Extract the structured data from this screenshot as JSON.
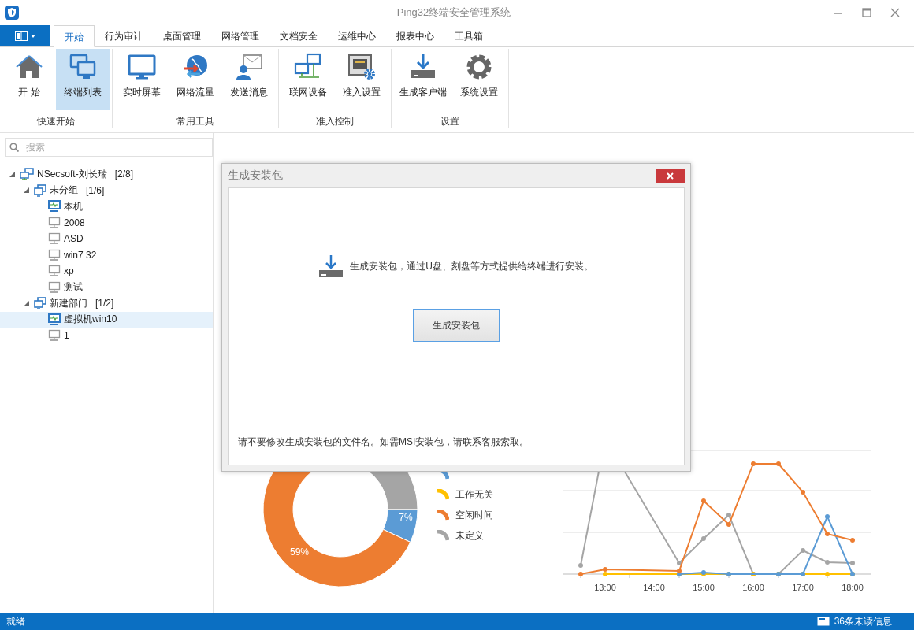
{
  "window": {
    "title": "Ping32终端安全管理系统"
  },
  "ribbon_tabs": [
    {
      "label": "开始",
      "selected": true
    },
    {
      "label": "行为审计",
      "selected": false
    },
    {
      "label": "桌面管理",
      "selected": false
    },
    {
      "label": "网络管理",
      "selected": false
    },
    {
      "label": "文档安全",
      "selected": false
    },
    {
      "label": "运维中心",
      "selected": false
    },
    {
      "label": "报表中心",
      "selected": false
    },
    {
      "label": "工具箱",
      "selected": false
    }
  ],
  "ribbon_groups": [
    {
      "label": "快速开始",
      "buttons": [
        {
          "label": "开 始",
          "kind": "home",
          "selected": false
        },
        {
          "label": "终端列表",
          "kind": "monitors",
          "selected": true
        }
      ]
    },
    {
      "label": "常用工具",
      "buttons": [
        {
          "label": "实时屏幕",
          "kind": "monitor",
          "selected": false
        },
        {
          "label": "网络流量",
          "kind": "globe",
          "selected": false
        },
        {
          "label": "发送消息",
          "kind": "message",
          "selected": false
        }
      ]
    },
    {
      "label": "准入控制",
      "buttons": [
        {
          "label": "联网设备",
          "kind": "network",
          "selected": false
        },
        {
          "label": "准入设置",
          "kind": "port",
          "selected": false
        }
      ]
    },
    {
      "label": "设置",
      "buttons": [
        {
          "label": "生成客户端",
          "kind": "download",
          "selected": false
        },
        {
          "label": "系统设置",
          "kind": "gear",
          "selected": false
        }
      ]
    }
  ],
  "sidebar": {
    "search": {
      "placeholder": "搜索"
    },
    "tree": [
      {
        "label": "NSecsoft-刘长瑞",
        "count": "[2/8]",
        "kind": "network",
        "expanded": true,
        "children": [
          {
            "label": "未分组",
            "count": "[1/6]",
            "kind": "group",
            "expanded": true,
            "children": [
              {
                "label": "本机",
                "kind": "terminal",
                "online": true,
                "selected": false
              },
              {
                "label": "2008",
                "kind": "terminal",
                "online": false,
                "selected": false
              },
              {
                "label": "ASD",
                "kind": "terminal",
                "online": false,
                "selected": false
              },
              {
                "label": "win7 32",
                "kind": "terminal",
                "online": false,
                "selected": false
              },
              {
                "label": "xp",
                "kind": "terminal",
                "online": false,
                "selected": false
              },
              {
                "label": "测试",
                "kind": "terminal",
                "online": false,
                "selected": false
              }
            ]
          },
          {
            "label": "新建部门",
            "count": "[1/2]",
            "kind": "group",
            "expanded": true,
            "children": [
              {
                "label": "虚拟机win10",
                "kind": "terminal",
                "online": true,
                "selected": true
              },
              {
                "label": "1",
                "kind": "terminal",
                "online": false,
                "selected": false
              }
            ]
          }
        ]
      }
    ]
  },
  "donut": {
    "labels": [
      "59%",
      "7%"
    ]
  },
  "legend": [
    {
      "color": "#5b9bd5"
    },
    {
      "label": "工作无关",
      "color": "#ffc000"
    },
    {
      "label": "空闲时间",
      "color": "#ed7d31"
    },
    {
      "label": "未定义",
      "color": "#a5a5a5"
    }
  ],
  "line_chart": {
    "x_labels": [
      "13:00",
      "14:00",
      "15:00",
      "16:00",
      "17:00",
      "18:00"
    ]
  },
  "dialog": {
    "title": "生成安装包",
    "message": "生成安装包，通过U盘、刻盘等方式提供给终端进行安装。",
    "button": "生成安装包",
    "note": "请不要修改生成安装包的文件名。如需MSI安装包，请联系客服索取。"
  },
  "status_bar": {
    "text": "就绪",
    "messages": "36条未读信息"
  }
}
